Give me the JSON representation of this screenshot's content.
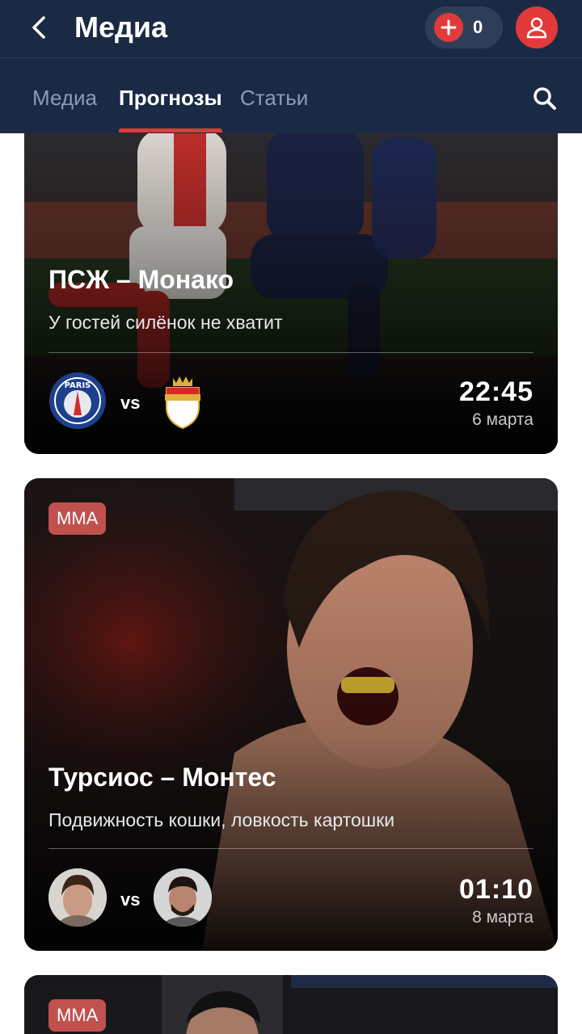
{
  "header": {
    "title": "Медиа",
    "coins_count": "0",
    "icons": {
      "back": "chevron-left-icon",
      "plus": "plus-icon",
      "profile": "user-icon",
      "search": "search-icon"
    }
  },
  "tabs": [
    {
      "label": "Медиа",
      "active": false
    },
    {
      "label": "Прогнозы",
      "active": true
    },
    {
      "label": "Статьи",
      "active": false
    }
  ],
  "cards": [
    {
      "title": "ПСЖ – Монако",
      "subtitle": "У гостей силёнок не хватит",
      "home": "PARIS SAINT-GERMAIN",
      "vs": "vs",
      "away": "AS MONACO",
      "time": "22:45",
      "date": "6 марта"
    },
    {
      "badge": "MMA",
      "title": "Турсиос – Монтес",
      "subtitle": "Подвижность кошки, ловкость картошки",
      "vs": "vs",
      "time": "01:10",
      "date": "8 марта"
    },
    {
      "badge": "MMA"
    }
  ],
  "colors": {
    "header_bg": "#1b2a44",
    "accent": "#e23a3a",
    "badge": "#c0514f"
  }
}
